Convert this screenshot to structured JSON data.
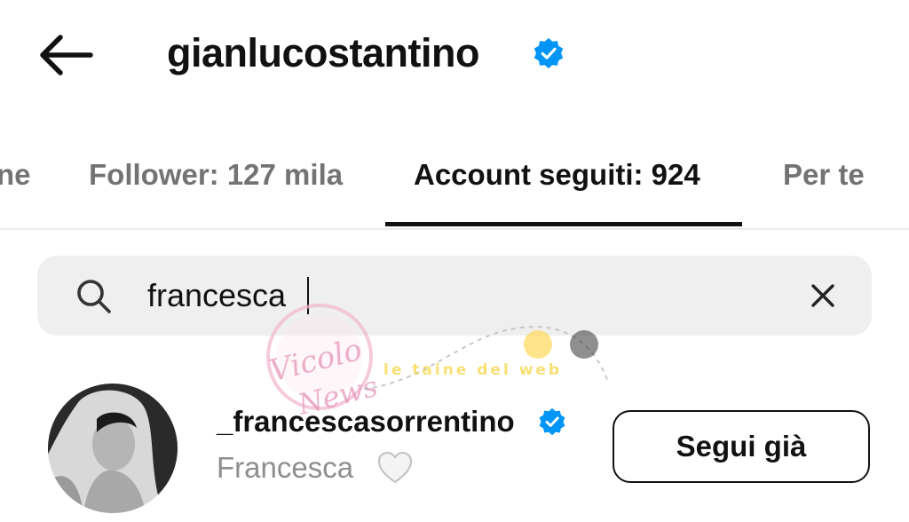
{
  "header": {
    "back_icon": "arrow-left-icon",
    "title": "gianlucostantino",
    "verified_icon": "verified-badge-icon"
  },
  "tabs": [
    {
      "label": "ne",
      "active": false
    },
    {
      "label": "Follower: 127 mila",
      "active": false
    },
    {
      "label": "Account seguiti: 924",
      "active": true
    },
    {
      "label": "Per te",
      "active": false
    }
  ],
  "search": {
    "icon": "search-icon",
    "value": "francesca",
    "clear_icon": "close-icon"
  },
  "watermark": {
    "logo_text": "Vicolo delle News",
    "tagline": "le taine del web"
  },
  "results": [
    {
      "username": "_francescasorrentino",
      "verified": true,
      "full_name": "Francesca",
      "emoji": "white-heart-icon",
      "button_label": "Segui già"
    }
  ],
  "colors": {
    "verified_blue": "#0095f6",
    "secondary_text": "#737373",
    "search_bg": "#efefef"
  }
}
